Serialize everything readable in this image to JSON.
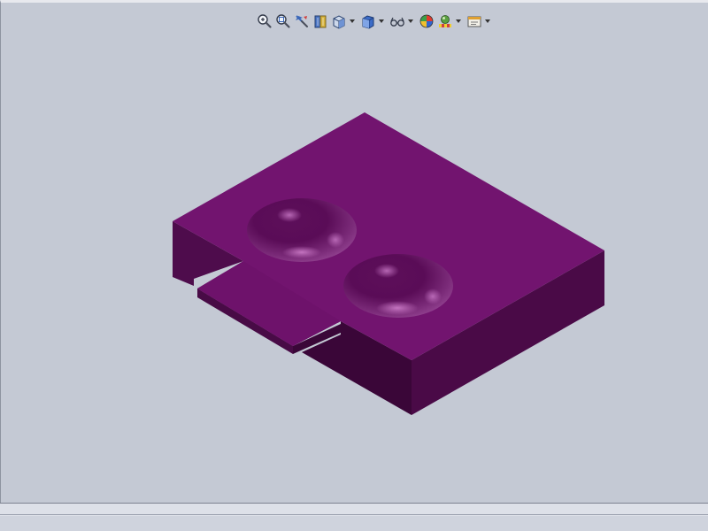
{
  "window": {
    "viewport_label": "graphics-area"
  },
  "toolbar": {
    "items": [
      {
        "icon": "zoom-to-fit-icon",
        "has_dropdown": false
      },
      {
        "icon": "zoom-to-area-icon",
        "has_dropdown": false
      },
      {
        "icon": "previous-view-icon",
        "has_dropdown": false
      },
      {
        "icon": "section-view-icon",
        "has_dropdown": false
      },
      {
        "icon": "view-orientation-icon",
        "has_dropdown": true
      },
      {
        "icon": "display-style-icon",
        "has_dropdown": true
      },
      {
        "icon": "hide-show-items-icon",
        "has_dropdown": true
      },
      {
        "icon": "edit-appearance-icon",
        "has_dropdown": false
      },
      {
        "icon": "apply-scene-icon",
        "has_dropdown": true
      },
      {
        "icon": "view-settings-icon",
        "has_dropdown": true
      }
    ]
  },
  "model": {
    "part_color_top": "#72146f",
    "part_color_left": "#520c50",
    "part_color_right": "#43083f",
    "dimple_count": 2
  },
  "colors": {
    "background": "#c4c9d4",
    "status_bar": "#dde0e8"
  }
}
